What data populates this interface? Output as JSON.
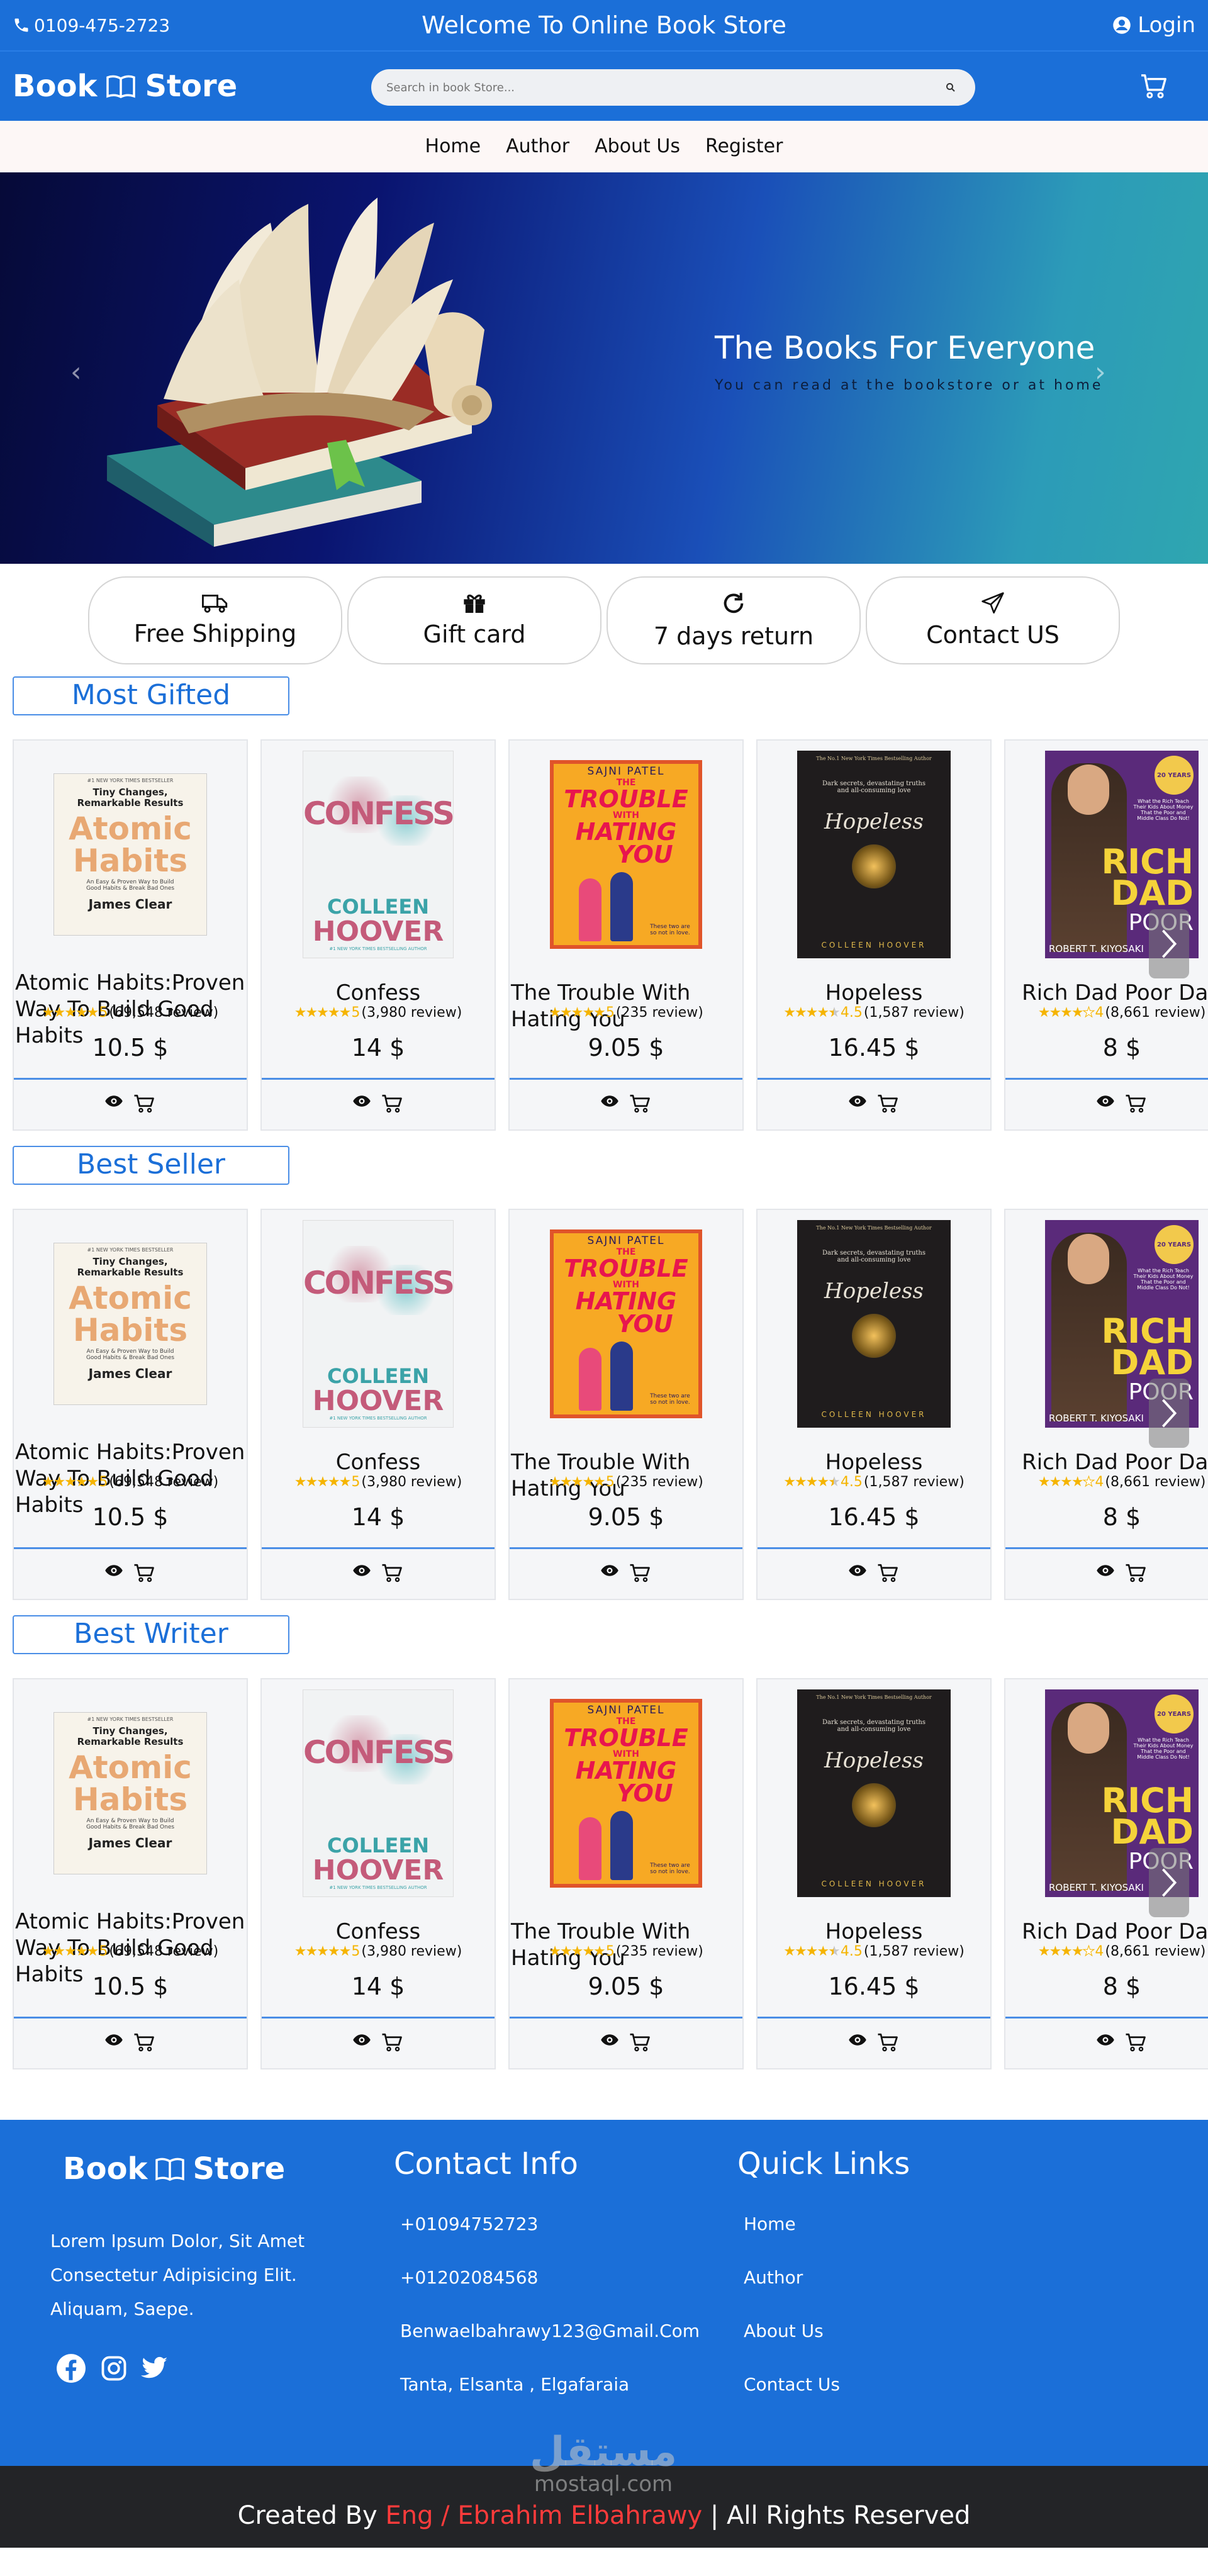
{
  "topbar": {
    "phone": "0109-475-2723",
    "welcome": "Welcome To Online Book Store",
    "login": "Login"
  },
  "header": {
    "brand_left": "Book",
    "brand_right": "Store",
    "search_placeholder": "Search in book Store..."
  },
  "nav": [
    "Home",
    "Author",
    "About Us",
    "Register"
  ],
  "hero": {
    "title": "The Books For Everyone",
    "subtitle": "You can read at the bookstore or at home"
  },
  "features": [
    {
      "label": "Free Shipping",
      "icon": "truck-icon"
    },
    {
      "label": "Gift card",
      "icon": "gift-icon"
    },
    {
      "label": "7 days return",
      "icon": "refresh-icon"
    },
    {
      "label": "Contact US",
      "icon": "send-icon"
    }
  ],
  "sections": [
    {
      "title": "Most Gifted"
    },
    {
      "title": "Best Seller"
    },
    {
      "title": "Best Writer"
    }
  ],
  "books": [
    {
      "title": "Atomic Habits:Proven Way To Build Good Habits",
      "rating": "5",
      "stars": 5,
      "reviews": "(69,548 review)",
      "price": "10.5 $",
      "cover": "atomic",
      "cover_top": "#1 NEW YORK TIMES BESTSELLER",
      "cover_sub": "Tiny Changes, Remarkable Results",
      "cover_word1": "Atomic",
      "cover_word2": "Habits",
      "cover_blurb": "An Easy & Proven Way to Build Good Habits & Break Bad Ones",
      "cover_author": "James Clear"
    },
    {
      "title": "Confess",
      "rating": "5",
      "stars": 5,
      "reviews": "(3,980 review)",
      "price": "14 $",
      "cover": "confess",
      "cover_word1": "CONFESS",
      "cover_author1": "COLLEEN",
      "cover_author2": "HOOVER",
      "cover_bottom": "#1 NEW YORK TIMES BESTSELLING AUTHOR"
    },
    {
      "title": "The Trouble With Hating You",
      "rating": "5",
      "stars": 5,
      "reviews": "(235 review)",
      "price": "9.05 $",
      "cover": "trouble",
      "cover_author": "SAJNI PATEL",
      "cover_word1": "THE",
      "cover_word2": "TROUBLE",
      "cover_word3": "WITH",
      "cover_word4": "HATING",
      "cover_word5": "YOU",
      "cover_tag": "These two are so not in love."
    },
    {
      "title": "Hopeless",
      "rating": "4.5",
      "stars": 4.5,
      "reviews": "(1,587 review)",
      "price": "16.45 $",
      "cover": "hopeless",
      "cover_top": "The No.1 New York Times Bestselling Author",
      "cover_blurb": "Dark secrets, devastating truths and all-consuming love",
      "cover_word1": "Hopeless",
      "cover_author": "COLLEEN HOOVER"
    },
    {
      "title": "Rich Dad Poor Dad",
      "rating": "4",
      "stars": 4,
      "reviews": "(8,661 review)",
      "price": "8 $",
      "cover": "richdad",
      "cover_badge": "20 YEARS",
      "cover_blurb": "What the Rich Teach Their Kids About Money That the Poor and Middle Class Do Not!",
      "cover_word1": "RICH",
      "cover_word2": "DAD",
      "cover_word3": "POOR",
      "cover_author": "ROBERT T. KIYOSAKI"
    }
  ],
  "footer": {
    "brand_left": "Book",
    "brand_right": "Store",
    "about": "Lorem Ipsum Dolor, Sit Amet Consectetur Adipisicing Elit. Aliquam, Saepe.",
    "contact_title": "Contact Info",
    "contacts": [
      "+01094752723",
      "+01202084568",
      "Benwaelbahrawy123@Gmail.Com",
      "Tanta, Elsanta , Elgafaraia"
    ],
    "links_title": "Quick Links",
    "links": [
      "Home",
      "Author",
      "About Us",
      "Contact Us"
    ]
  },
  "bottom": {
    "prefix": "Created By",
    "name": "Eng / Ebrahim Elbahrawy",
    "suffix": "| All Rights Reserved",
    "watermark_ar": "مستقل",
    "watermark_en": "mostaql.com"
  },
  "colors": {
    "primary": "#1b6fd8",
    "star": "#f5b400",
    "footer_dark": "#232427",
    "credit_name": "#ff3b3b"
  }
}
